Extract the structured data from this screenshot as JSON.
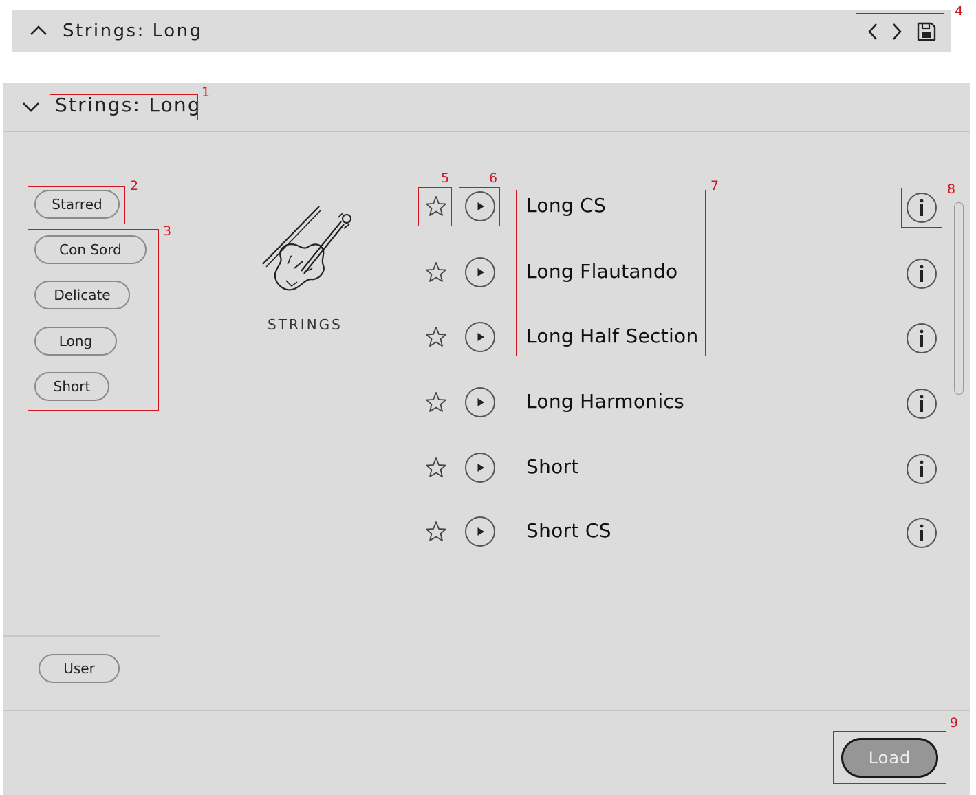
{
  "top_bar": {
    "title": "Strings: Long",
    "collapse_icon": "chevron-up-icon",
    "prev_icon": "chevron-left-icon",
    "next_icon": "chevron-right-icon",
    "save_icon": "save-disk-icon"
  },
  "panel": {
    "title": "Strings: Long",
    "expand_icon": "chevron-down-icon"
  },
  "filters": {
    "starred_label": "Starred",
    "tags": [
      "Con Sord",
      "Delicate",
      "Long",
      "Short"
    ],
    "user_label": "User"
  },
  "category": {
    "label": "STRINGS",
    "icon": "violin-bow-icon"
  },
  "presets": [
    {
      "name": "Long CS"
    },
    {
      "name": "Long Flautando"
    },
    {
      "name": "Long Half Section"
    },
    {
      "name": "Long Harmonics"
    },
    {
      "name": "Short"
    },
    {
      "name": "Short CS"
    }
  ],
  "footer": {
    "load_label": "Load"
  },
  "callouts": [
    "1",
    "2",
    "3",
    "4",
    "5",
    "6",
    "7",
    "8",
    "9"
  ],
  "colors": {
    "panel_bg": "#dcdcdc",
    "callout_red": "#d0161f",
    "load_button_bg": "#969696"
  }
}
